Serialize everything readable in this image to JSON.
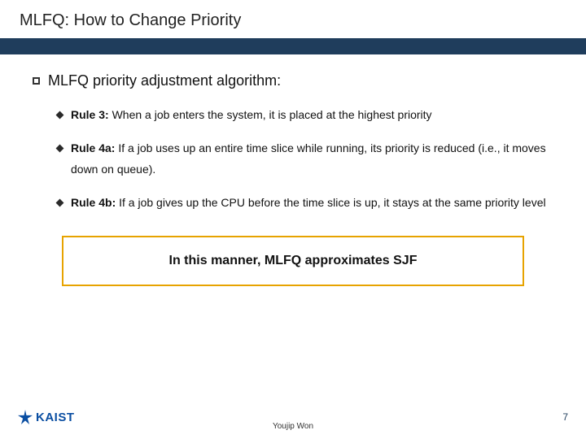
{
  "title": "MLFQ: How to Change Priority",
  "main_bullet": "MLFQ priority adjustment algorithm:",
  "rules": [
    {
      "label": "Rule 3:",
      "body": " When a job enters the system, it is placed at the highest priority"
    },
    {
      "label": "Rule 4a:",
      "body": " If a job uses up an entire time slice while running, its priority is reduced (i.e., it moves down on queue)."
    },
    {
      "label": "Rule 4b:",
      "body": " If a job gives up the CPU before the time slice is up, it stays at the same priority level"
    }
  ],
  "callout": "In this manner, MLFQ approximates SJF",
  "footer": {
    "logo_text": "KAIST",
    "author": "Youjip Won",
    "page": "7"
  }
}
